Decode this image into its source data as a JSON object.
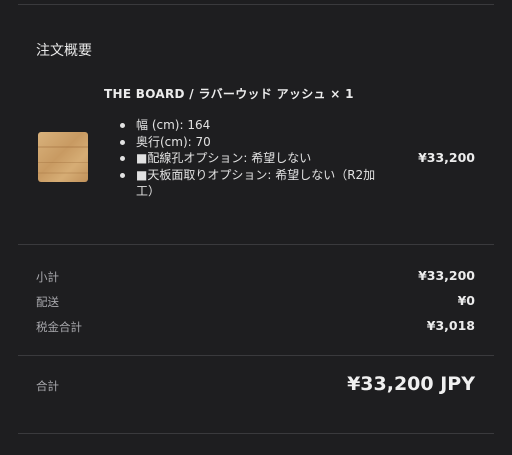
{
  "summary": {
    "title": "注文概要",
    "item": {
      "name": "THE BOARD / ラバーウッド アッシュ × 1",
      "image_alt": "product-thumbnail",
      "options": [
        "幅 (cm): 164",
        "奥行(cm): 70",
        "■配線孔オプション: 希望しない",
        "■天板面取りオプション: 希望しない（R2加工）"
      ],
      "price": "¥33,200"
    },
    "subtotal": {
      "label": "小計",
      "value": "¥33,200"
    },
    "shipping": {
      "label": "配送",
      "value": "¥0"
    },
    "tax": {
      "label": "税金合計",
      "value": "¥3,018"
    },
    "total": {
      "label": "合計",
      "value": "¥33,200 JPY"
    }
  },
  "colors": {
    "background": "#1e1e20",
    "divider": "#3a3a3d",
    "muted_text": "#a8a8ac"
  }
}
